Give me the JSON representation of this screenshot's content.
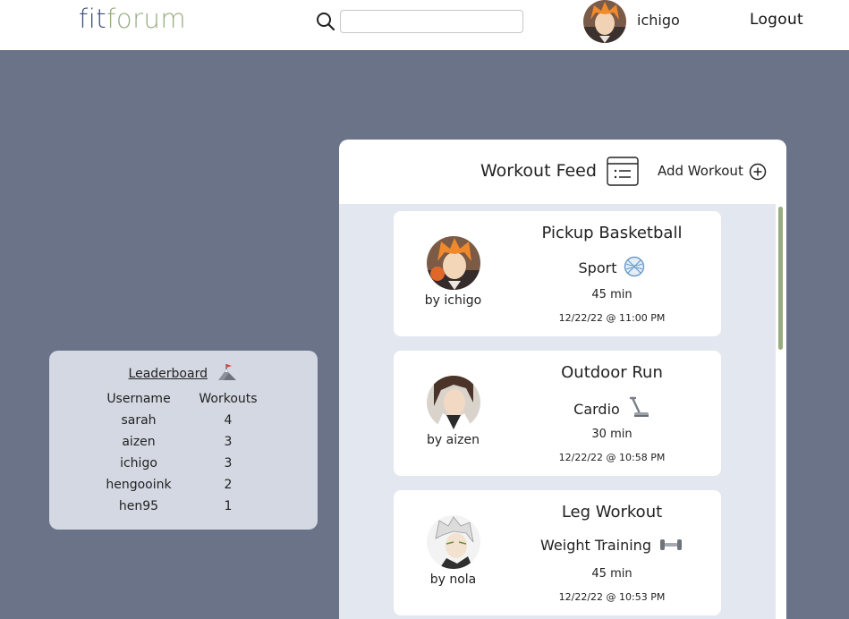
{
  "header": {
    "logo_fit": "fit",
    "logo_forum": "forum",
    "search_placeholder": "",
    "username": "ichigo",
    "logout_label": "Logout"
  },
  "leaderboard": {
    "title": "Leaderboard",
    "columns": [
      "Username",
      "Workouts"
    ],
    "rows": [
      {
        "username": "sarah",
        "workouts": "4"
      },
      {
        "username": "aizen",
        "workouts": "3"
      },
      {
        "username": "ichigo",
        "workouts": "3"
      },
      {
        "username": "hengooink",
        "workouts": "2"
      },
      {
        "username": "hen95",
        "workouts": "1"
      }
    ]
  },
  "feed": {
    "title": "Workout Feed",
    "add_label": "Add Workout",
    "cards": [
      {
        "by": "by ichigo",
        "title": "Pickup Basketball",
        "category": "Sport",
        "category_icon": "basketball-icon",
        "duration": "45 min",
        "timestamp": "12/22/22 @ 11:00 PM"
      },
      {
        "by": "by aizen",
        "title": "Outdoor Run",
        "category": "Cardio",
        "category_icon": "treadmill-icon",
        "duration": "30 min",
        "timestamp": "12/22/22 @ 10:58 PM"
      },
      {
        "by": "by nola",
        "title": "Leg Workout",
        "category": "Weight Training",
        "category_icon": "dumbbell-icon",
        "duration": "45 min",
        "timestamp": "12/22/22 @ 10:53 PM"
      }
    ]
  },
  "colors": {
    "background": "#6b7389",
    "accent_green": "#97ad80",
    "logo_blue": "#3d4f7a",
    "leaderboard_bg": "#d3d8e2",
    "feed_bg": "#e3e7ef"
  }
}
